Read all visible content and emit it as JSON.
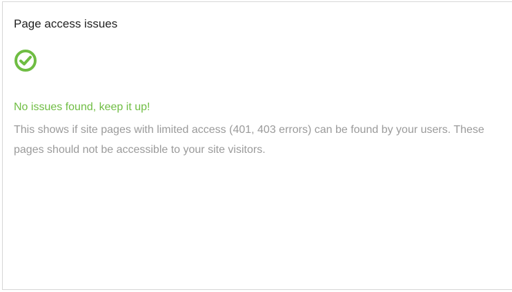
{
  "card": {
    "title": "Page access issues",
    "status_icon": "check-circle-icon",
    "status_color": "#6fbd43",
    "status_title": "No issues found, keep it up!",
    "description": "This shows if site pages with limited access (401, 403 errors) can be found by your users. These pages should not be accessible to your site visitors."
  }
}
